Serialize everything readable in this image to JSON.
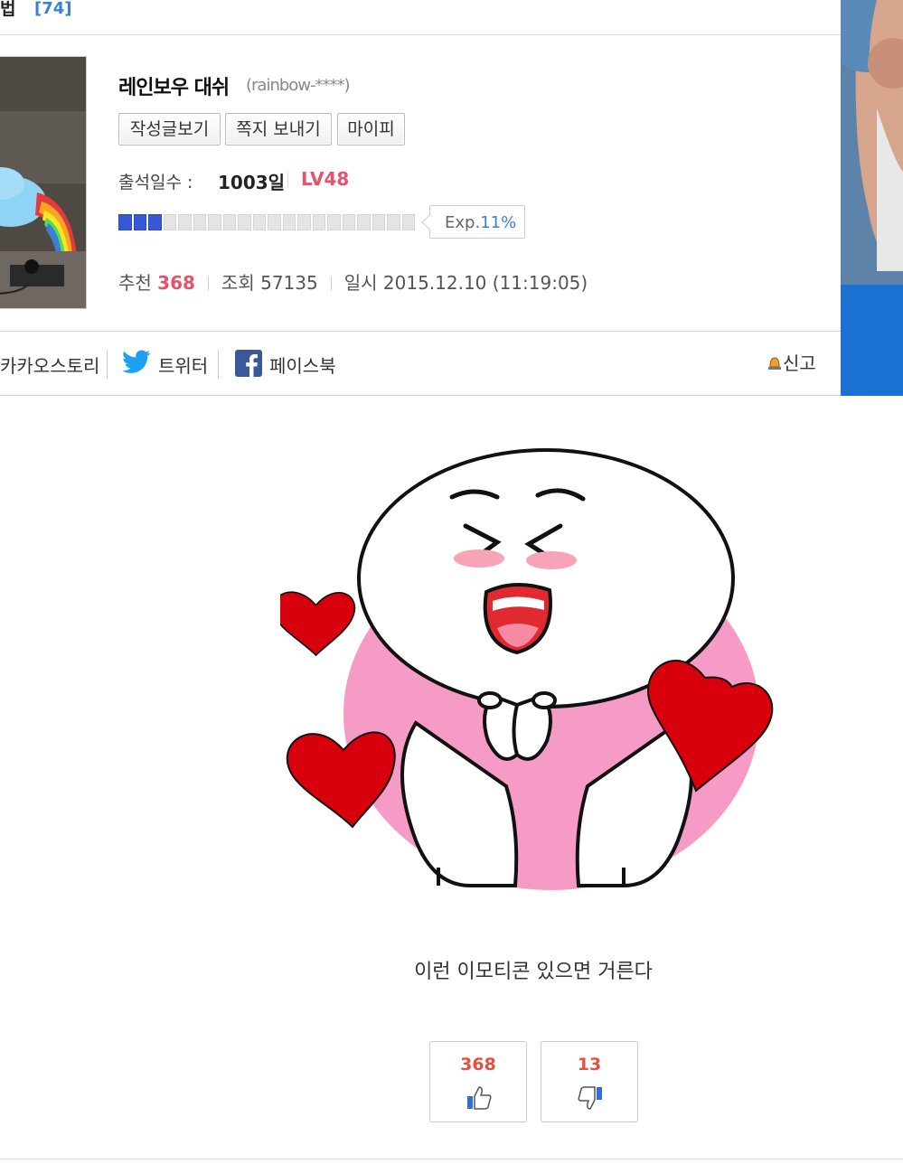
{
  "board": {
    "category_fragment": "법",
    "comment_count": "[74]"
  },
  "author": {
    "name": "레인보우 대쉬",
    "id": "(rainbow-****)"
  },
  "buttons": {
    "posts": "작성글보기",
    "message": "쪽지 보내기",
    "mypi": "마이피"
  },
  "stats": {
    "attendance_label": "출석일수 :",
    "attendance_value": "1003일",
    "level": "LV48",
    "exp_label": "Exp.",
    "exp_percent": "11%",
    "exp_fraction": 0.11
  },
  "meta": {
    "recommend_label": "추천",
    "recommend_value": "368",
    "views_label": "조회",
    "views_value": "57135",
    "date_label": "일시",
    "date_value": "2015.12.10 (11:19:05)"
  },
  "share": {
    "kakao": "카카오스토리",
    "twitter": "트위터",
    "facebook": "페이스북",
    "report": "신고"
  },
  "post": {
    "caption": "이런 이모티콘 있으면 거른다"
  },
  "votes": {
    "up": "368",
    "down": "13"
  },
  "colors": {
    "accent_red": "#e6516b",
    "link_blue": "#3b7fd4",
    "exp_fill": "#3558d8",
    "vote_red": "#e2523e"
  },
  "icons": [
    "twitter-icon",
    "facebook-icon",
    "siren-icon",
    "thumbs-up-icon",
    "thumbs-down-icon"
  ]
}
